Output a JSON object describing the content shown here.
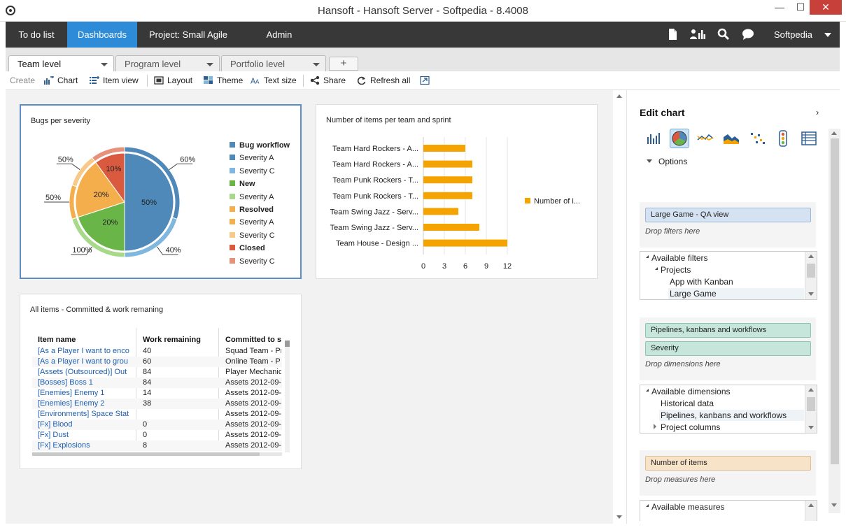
{
  "window": {
    "title": "Hansoft - Hansoft Server - Softpedia - 8.4008",
    "minimize": "—",
    "maximize": "☐",
    "close": "✕"
  },
  "nav": {
    "items": [
      {
        "label": "To do list"
      },
      {
        "label": "Dashboards"
      },
      {
        "label": "Project: Small Agile"
      },
      {
        "label": "Admin"
      }
    ],
    "user": "Softpedia"
  },
  "tabs": [
    {
      "label": "Team level"
    },
    {
      "label": "Program level"
    },
    {
      "label": "Portfolio level"
    }
  ],
  "tab_add": "+",
  "toolbar": {
    "create": "Create",
    "chart": "Chart",
    "item_view": "Item view",
    "layout": "Layout",
    "theme": "Theme",
    "text_size": "Text size",
    "share": "Share",
    "refresh_all": "Refresh all"
  },
  "pie_card": {
    "title": "Bugs per severity",
    "legend": [
      {
        "label": "Bug workflow",
        "color": "#4e89b9",
        "bold": true
      },
      {
        "label": "Severity A",
        "color": "#4e89b9",
        "bold": false
      },
      {
        "label": "Severity C",
        "color": "#7fb7de",
        "bold": false
      },
      {
        "label": "New",
        "color": "#6ab547",
        "bold": true
      },
      {
        "label": "Severity A",
        "color": "#a8d98a",
        "bold": false
      },
      {
        "label": "Resolved",
        "color": "#f5ae4c",
        "bold": true
      },
      {
        "label": "Severity A",
        "color": "#f5ae4c",
        "bold": false
      },
      {
        "label": "Severity C",
        "color": "#f7ca8c",
        "bold": false
      },
      {
        "label": "Closed",
        "color": "#d95a3e",
        "bold": true
      },
      {
        "label": "Severity C",
        "color": "#e8917a",
        "bold": false
      }
    ]
  },
  "chart_data": [
    {
      "type": "pie",
      "title": "Bugs per severity",
      "inner": [
        {
          "name": "Bug workflow",
          "value": 50,
          "label": "50%",
          "color": "#4e89b9"
        },
        {
          "name": "New",
          "value": 20,
          "label": "20%",
          "color": "#6ab547"
        },
        {
          "name": "Resolved",
          "value": 20,
          "label": "20%",
          "color": "#f5ae4c"
        },
        {
          "name": "Closed",
          "value": 10,
          "label": "10%",
          "color": "#d95a3e"
        }
      ],
      "outer": [
        {
          "name": "Severity A",
          "parent": "Bug workflow",
          "share": 60,
          "label": "60%",
          "color": "#4e89b9"
        },
        {
          "name": "Severity C",
          "parent": "Bug workflow",
          "share": 40,
          "label": "40%",
          "color": "#7fb7de"
        },
        {
          "name": "Severity A",
          "parent": "New",
          "share": 100,
          "label": "100%",
          "color": "#a8d98a"
        },
        {
          "name": "Severity A",
          "parent": "Resolved",
          "share": 50,
          "label": "50%",
          "color": "#f5ae4c"
        },
        {
          "name": "Severity C",
          "parent": "Resolved",
          "share": 50,
          "label": "50%",
          "color": "#f7ca8c"
        },
        {
          "name": "Severity C",
          "parent": "Closed",
          "share": 100,
          "label": "",
          "color": "#e8917a"
        }
      ]
    },
    {
      "type": "bar",
      "orientation": "horizontal",
      "title": "Number of items per team and sprint",
      "categories": [
        "Team Hard Rockers - A...",
        "Team Hard Rockers - A...",
        "Team Punk Rockers - T...",
        "Team  Punk Rockers - T...",
        "Team Swing Jazz - Serv...",
        "Team Swing Jazz - Serv...",
        "Team House - Design ..."
      ],
      "series": [
        {
          "name": "Number of i...",
          "values": [
            6,
            7,
            7,
            7,
            5,
            8,
            12
          ],
          "color": "#f5a300"
        }
      ],
      "xticks": [
        "0",
        "3",
        "6",
        "9",
        "12"
      ],
      "xlim": [
        0,
        13
      ],
      "legend": "right"
    }
  ],
  "table_card": {
    "title": "All items - Committed & work remaning",
    "headers": [
      "Item name",
      "Work remaining",
      "Committed to s"
    ],
    "rows": [
      [
        "[As a Player I want to enco",
        "40",
        "Squad Team - Pr"
      ],
      [
        "[As a Player I want to grou",
        "60",
        "Online Team - P"
      ],
      [
        "[Assets (Outsourced)] Out",
        "84",
        "Player Mechanic"
      ],
      [
        "[Bosses] Boss 1",
        "84",
        "Assets 2012-09-"
      ],
      [
        "[Enemies] Enemy 1",
        "14",
        "Assets 2012-09-"
      ],
      [
        "[Enemies] Enemy 2",
        "38",
        "Assets 2012-09-"
      ],
      [
        "[Environments] Space Stat",
        "",
        "Assets 2012-09-"
      ],
      [
        "[Fx] Blood",
        "0",
        "Assets 2012-09-"
      ],
      [
        "[Fx] Dust",
        "0",
        "Assets 2012-09-"
      ],
      [
        "[Fx] Explosions",
        "8",
        "Assets 2012-09-"
      ]
    ]
  },
  "sidebar": {
    "title": "Edit chart",
    "options": "Options",
    "filter_chip": "Large Game - QA view",
    "drop_filters": "Drop filters here",
    "filters_list": [
      "Available filters",
      "Projects",
      "App with Kanban",
      "Large Game"
    ],
    "dim_chips": [
      "Pipelines, kanbans and workflows",
      "Severity"
    ],
    "drop_dimensions": "Drop dimensions here",
    "dims_list": [
      "Available dimensions",
      "Historical data",
      "Pipelines, kanbans and workflows",
      "Project columns"
    ],
    "measure_chip": "Number of items",
    "drop_measures": "Drop measures here",
    "measures_list": [
      "Available measures"
    ]
  }
}
